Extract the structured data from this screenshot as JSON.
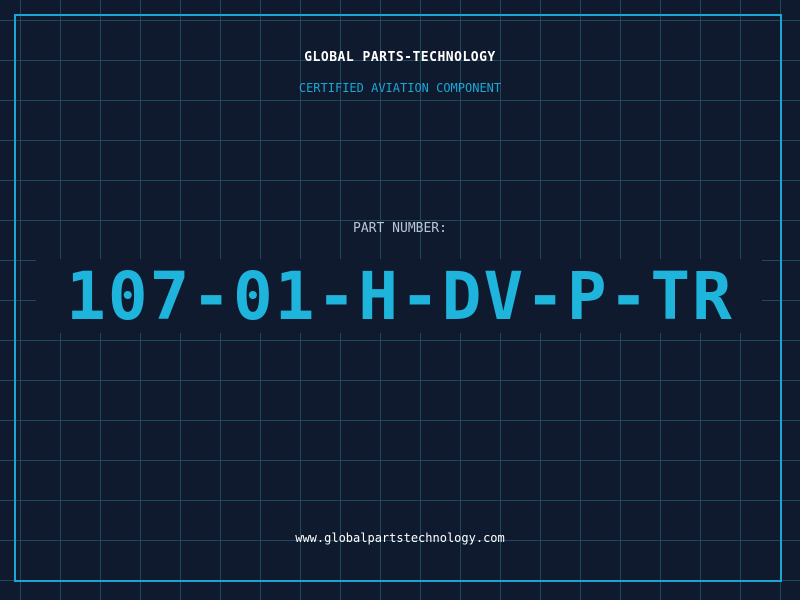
{
  "header": {
    "company": "GLOBAL PARTS-TECHNOLOGY",
    "tagline": "CERTIFIED AVIATION COMPONENT"
  },
  "part": {
    "label": "PART NUMBER:",
    "number": "107-01-H-DV-P-TR"
  },
  "footer": {
    "url": "www.globalpartstechnology.com"
  },
  "colors": {
    "background": "#0f1a2e",
    "grid": "#1f4a5e",
    "accent": "#1aa7d6",
    "part_number": "#1eb4dc"
  }
}
